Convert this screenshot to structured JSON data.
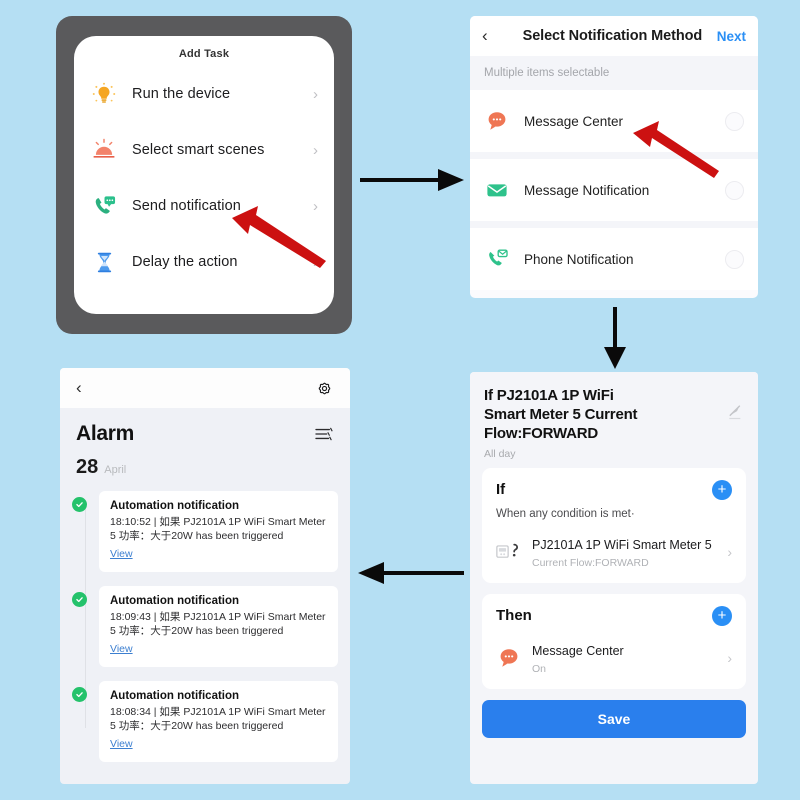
{
  "background_color": "#b5dff3",
  "add_task_screen": {
    "title": "Add Task",
    "items": [
      {
        "icon": "light-bulb-icon",
        "label": "Run the device",
        "chevron": "›"
      },
      {
        "icon": "smart-scene-icon",
        "label": "Select smart scenes",
        "chevron": "›"
      },
      {
        "icon": "send-notification-icon",
        "label": "Send notification",
        "chevron": "›"
      },
      {
        "icon": "hourglass-icon",
        "label": "Delay the action",
        "chevron": "›"
      }
    ],
    "highlight_arrow": "points at Send notification"
  },
  "notification_method_screen": {
    "back": "‹",
    "title": "Select Notification Method",
    "next_label": "Next",
    "next_color": "#2a8ff5",
    "subtitle": "Multiple items selectable",
    "items": [
      {
        "icon": "message-bubble-icon",
        "label": "Message Center",
        "selected": false
      },
      {
        "icon": "envelope-icon",
        "label": "Message Notification",
        "selected": false
      },
      {
        "icon": "phone-message-icon",
        "label": "Phone Notification",
        "selected": false
      }
    ],
    "highlight_arrow": "points at Message Center"
  },
  "automation_detail_screen": {
    "title": "If PJ2101A 1P WiFi\nSmart Meter  5 Current\nFlow:FORWARD",
    "schedule": "All day",
    "edit_icon": "pencil-icon",
    "if_card": {
      "heading": "If",
      "add_icon": "plus-icon",
      "condition_text": "When any condition is met·",
      "device_name": "PJ2101A 1P WiFi Smart Meter 5",
      "device_state": "Current Flow:FORWARD",
      "chevron": "›"
    },
    "then_card": {
      "heading": "Then",
      "add_icon": "plus-icon",
      "action_name": "Message Center",
      "action_state": "On",
      "chevron": "›"
    },
    "save_label": "Save",
    "save_color": "#2a7fed"
  },
  "alarm_screen": {
    "back": "‹",
    "settings_icon": "gear-icon",
    "title": "Alarm",
    "filter_icon": "filter-list-icon",
    "date_day": "28",
    "date_month": "April",
    "notifications": [
      {
        "status": "success",
        "title": "Automation notification",
        "body": "18:10:52 | 如果 PJ2101A 1P WiFi Smart Meter  5 功率：大于20W has been triggered",
        "link": "View"
      },
      {
        "status": "success",
        "title": "Automation notification",
        "body": "18:09:43 | 如果 PJ2101A 1P WiFi Smart Meter  5 功率：大于20W has been triggered",
        "link": "View"
      },
      {
        "status": "success",
        "title": "Automation notification",
        "body": "18:08:34 | 如果 PJ2101A 1P WiFi Smart Meter  5 功率：大于20W has been triggered",
        "link": "View"
      }
    ]
  },
  "flow_arrows": [
    {
      "name": "arrow-addtask-to-notify",
      "direction": "right"
    },
    {
      "name": "arrow-notify-to-automation",
      "direction": "down"
    },
    {
      "name": "arrow-automation-to-alarm",
      "direction": "left"
    }
  ]
}
